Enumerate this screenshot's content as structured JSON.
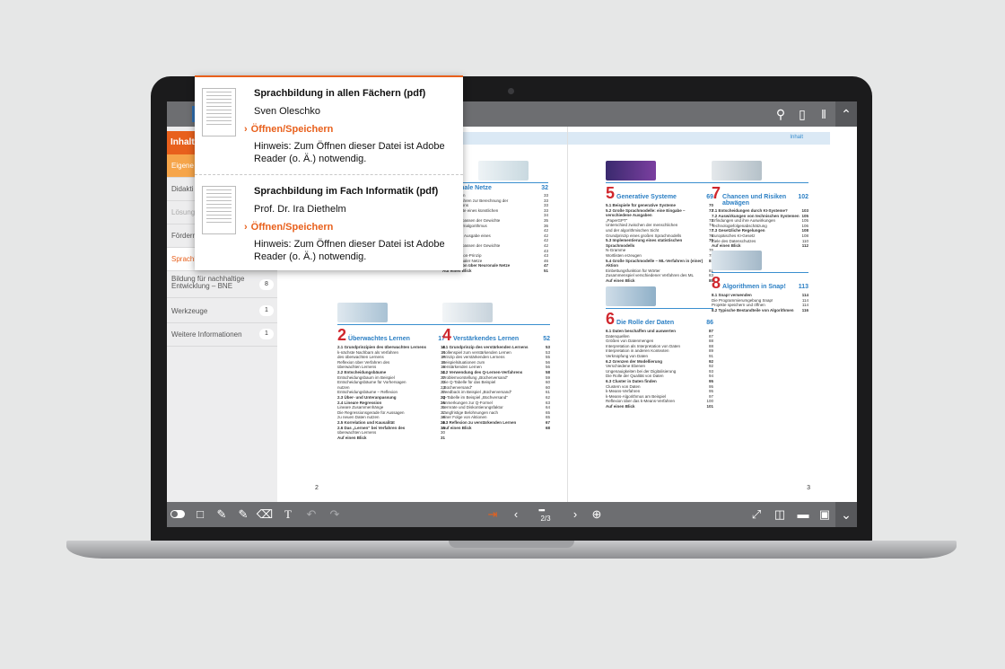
{
  "reader": {
    "brand_letter": "V",
    "top_icons": [
      "search-icon",
      "bookmark-icon",
      "tools-icon",
      "chevron-up-icon"
    ]
  },
  "sidebar": {
    "header": "Inhalt",
    "items": [
      {
        "label": "Eigene",
        "count": ""
      },
      {
        "label": "Didakti",
        "count": ""
      },
      {
        "label": "Lösung",
        "count": ""
      },
      {
        "label": "Förderm",
        "count": ""
      },
      {
        "label": "Sprachb",
        "count": ""
      },
      {
        "label": "Bildung für nachhaltige Entwicklung – BNE",
        "count": "8"
      },
      {
        "label": "Werkzeuge",
        "count": "1"
      },
      {
        "label": "Weitere Informationen",
        "count": "1"
      }
    ]
  },
  "book": {
    "band_label": "Inhalt",
    "left_page_number": "2",
    "right_page_number": "3",
    "chapters": [
      {
        "num": "",
        "title": "Neuronale Netze",
        "page": "32",
        "entries": [
          [
            "ches Neuron",
            "33"
          ],
          [
            "sches Verfahren zur Berechnung der",
            "33"
          ],
          [
            "eines Neurons",
            "33"
          ],
          [
            "der Gewichte eines künstlichen",
            "33"
          ],
          [
            "im Beispiel",
            "34"
          ],
          [
            "dischen Anpassen der Gewichte",
            "35"
          ],
          [
            "ur einen Lernalgorithmus",
            "36"
          ],
          [
            "nale Netze",
            "42"
          ],
          [
            "nterung der Ausgabe eines",
            "42"
          ],
          [
            "en Netzes",
            "42"
          ],
          [
            "dischen Anpassen der Gewichte",
            "42"
          ],
          [
            "Netze",
            "43"
          ],
          [
            "ckpropagation-Prinzip",
            "43"
          ],
          [
            "nkte neuronaler Netze",
            "46"
          ],
          [
            "3.5 Reflexion über Neuronale Netze",
            "47"
          ],
          [
            "Auf einen Blick",
            "51"
          ]
        ]
      },
      {
        "num": "2",
        "title": "Überwachtes Lernen",
        "page": "17",
        "entries": [
          [
            "2.1 Grundprinzipien des überwachten Lernens",
            "18"
          ],
          [
            "k-nächste Nachbarn als Verfahren",
            "18"
          ],
          [
            "des überwachten Lernens",
            "18"
          ],
          [
            "Reflexion über Verfahren des",
            "18"
          ],
          [
            "überwachten Lernens",
            "19"
          ],
          [
            "2.2 Entscheidungsbäume",
            "22"
          ],
          [
            "Entscheidungsbaum im Beispiel",
            "22"
          ],
          [
            "Entscheidungsbäume für Vorhersagen",
            "22"
          ],
          [
            "nutzen",
            "23"
          ],
          [
            "Entscheidungsbäume – Reflexion",
            "22"
          ],
          [
            "2.3 Über- und Unteranpassung",
            "24"
          ],
          [
            "2.4 Lineare Regression",
            "26"
          ],
          [
            "Lineare Zusammenhänge",
            "26"
          ],
          [
            "Die Regressionsgerade für Aussagen",
            "27"
          ],
          [
            "zu neuen Daten nutzen",
            "28"
          ],
          [
            "2.5 Korrelation und Kausalität",
            "29"
          ],
          [
            "2.6 Das „Lernen“ bei Verfahren des",
            "30"
          ],
          [
            "überwachten Lernens",
            "30"
          ],
          [
            "Auf einen Blick",
            "31"
          ]
        ]
      },
      {
        "num": "4",
        "title": "Verstärkendes Lernen",
        "page": "52",
        "entries": [
          [
            "4.1 Grundprinzip des verstärkenden Lernens",
            "53"
          ],
          [
            "Rollenspiel zum verstärkenden Lernen",
            "53"
          ],
          [
            "Prinzip des verstärkenden Lernens",
            "55"
          ],
          [
            "Beispielsituationen zum",
            "56"
          ],
          [
            "verstärkenden Lernen",
            "56"
          ],
          [
            "4.2 Verwendung des Q-Lernen-Verfahrens",
            "58"
          ],
          [
            "Problemvorstellung „Bücherversand“",
            "59"
          ],
          [
            "Die Q-Tabelle für das Beispiel",
            "60"
          ],
          [
            "„Bücherversand“",
            "60"
          ],
          [
            "Feedback im Beispiel „Bücherversand“",
            "61"
          ],
          [
            "Q-Tabelle im Beispiel „Büchversand“",
            "62"
          ],
          [
            "Anmerkungen zur Q-Formel",
            "63"
          ],
          [
            "Lernrate und Diskontierungsfaktor",
            "64"
          ],
          [
            "Langfristige Belohnungen nach",
            "65"
          ],
          [
            "einer Folge von Aktionen",
            "65"
          ],
          [
            "4.3 Reflexion zu verstärkenden Lernen",
            "67"
          ],
          [
            "Auf einen Blick",
            "68"
          ]
        ]
      },
      {
        "num": "5",
        "title": "Generative Systeme",
        "page": "69",
        "entries": [
          [
            "5.1 Beispiele für generative Systeme",
            "70"
          ],
          [
            "5.2 Große Sprachmodelle: eine Eingabe – verschiedene Ausgaben",
            "73"
          ],
          [
            "„PaperGPT“",
            "73"
          ],
          [
            "Unterschied zwischen der menschlichen",
            "74"
          ],
          [
            "und der algorithmischen Sicht",
            "74"
          ],
          [
            "Grundprinzip eines großen Sprachmodells",
            "76"
          ],
          [
            "5.3 Implementierung eines statistischen Sprachmodells",
            "76"
          ],
          [
            "N-Gramme",
            "76"
          ],
          [
            "Wortlisten erzeugen",
            "78"
          ],
          [
            "5.4 Große Sprachmodelle – ML-Verfahren in (einer) Aktion",
            "81"
          ],
          [
            "Einbettungsfunktion für Wörter",
            "81"
          ],
          [
            "Zusammenspiel verschiedener Verfahren des ML",
            "83"
          ],
          [
            "Auf einen Blick",
            "85"
          ]
        ]
      },
      {
        "num": "6",
        "title": "Die Rolle der Daten",
        "page": "86",
        "entries": [
          [
            "6.1 Daten beschaffen und auswerten",
            "87"
          ],
          [
            "Datenquellen",
            "87"
          ],
          [
            "Größen von Datenmengen",
            "88"
          ],
          [
            "Interpretation als Interpretation von Daten",
            "88"
          ],
          [
            "Interpretation in anderen Kontexten",
            "89"
          ],
          [
            "Verknüpfung von Daten",
            "91"
          ],
          [
            "6.2 Grenzen der Modellierung",
            "92"
          ],
          [
            "Verschiedene Ebenen",
            "92"
          ],
          [
            "Ungenauigkeiten bei der Digitalisierung",
            "93"
          ],
          [
            "Die Rolle der Qualität von Daten",
            "94"
          ],
          [
            "6.3 Cluster in Daten finden",
            "95"
          ],
          [
            "Clustern von Daten",
            "95"
          ],
          [
            "k-Means-Verfahren",
            "95"
          ],
          [
            "k-Means-Algorithmus am Beispiel",
            "97"
          ],
          [
            "Reflexion über das k-Means-Verfahren",
            "100"
          ],
          [
            "Auf einen Blick",
            "101"
          ]
        ]
      },
      {
        "num": "7",
        "title": "Chancen und Risiken abwägen",
        "page": "102",
        "entries": [
          [
            "7.1 Entscheidungen durch KI-Systeme?",
            "103"
          ],
          [
            "7.2 Auswirkungen von technischen Systemen",
            "105"
          ],
          [
            "Erfindungen und ihre Auswirkungen",
            "105"
          ],
          [
            "Technologiefolgenabschätzung",
            "106"
          ],
          [
            "7.3 Gesetzliche Regelungen",
            "108"
          ],
          [
            "Europäisches KI-Gesetz",
            "108"
          ],
          [
            "Ziele des Datenschutzes",
            "110"
          ],
          [
            "Auf einen Blick",
            "112"
          ]
        ]
      },
      {
        "num": "8",
        "title": "Algorithmen in Snap!",
        "page": "113",
        "entries": [
          [
            "8.1 Snap! verwenden",
            "114"
          ],
          [
            "Die Programmierumgebung Snap!",
            "114"
          ],
          [
            "Projekte speichern und öffnen",
            "114"
          ],
          [
            "8.2 Typische Bestandteile von Algorithmen",
            "116"
          ]
        ]
      }
    ]
  },
  "bottom_toolbar": {
    "page_indicator": "2/3",
    "page_dots": "▪▪▪"
  },
  "popup": {
    "entries": [
      {
        "title": "Sprachbildung in allen Fächern (pdf)",
        "author": "Sven Oleschko",
        "action": "Öffnen/Speichern",
        "hint": "Hinweis: Zum Öffnen dieser Datei ist Adobe Reader (o. Ä.) notwendig."
      },
      {
        "title": "Sprachbildung im Fach Informatik (pdf)",
        "author": "Prof. Dr. Ira Diethelm",
        "action": "Öffnen/Speichern",
        "hint": "Hinweis: Zum Öffnen dieser Datei ist Adobe Reader (o. Ä.) notwendig."
      }
    ]
  },
  "colors": {
    "accent": "#e8601c",
    "toolbar": "#6d6e71",
    "chapter_blue": "#2b7fc4",
    "chapter_red": "#d0272d"
  }
}
